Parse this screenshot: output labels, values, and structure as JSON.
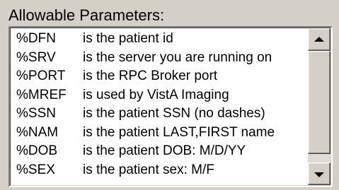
{
  "group": {
    "title": "Allowable Parameters:"
  },
  "params": [
    {
      "code": "%DFN",
      "desc": "is the patient id"
    },
    {
      "code": "%SRV",
      "desc": "is the server you are running on"
    },
    {
      "code": "%PORT",
      "desc": "is the RPC Broker port"
    },
    {
      "code": "%MREF",
      "desc": "is used by VistA Imaging"
    },
    {
      "code": "%SSN",
      "desc": "is the patient SSN (no dashes)"
    },
    {
      "code": "%NAM",
      "desc": "is the patient LAST,FIRST name"
    },
    {
      "code": "%DOB",
      "desc": "is the patient DOB: M/D/YY"
    },
    {
      "code": "%SEX",
      "desc": "is the patient sex: M/F"
    }
  ],
  "scrollbar": {
    "up_icon": "arrow-up-icon",
    "down_icon": "arrow-down-icon"
  }
}
